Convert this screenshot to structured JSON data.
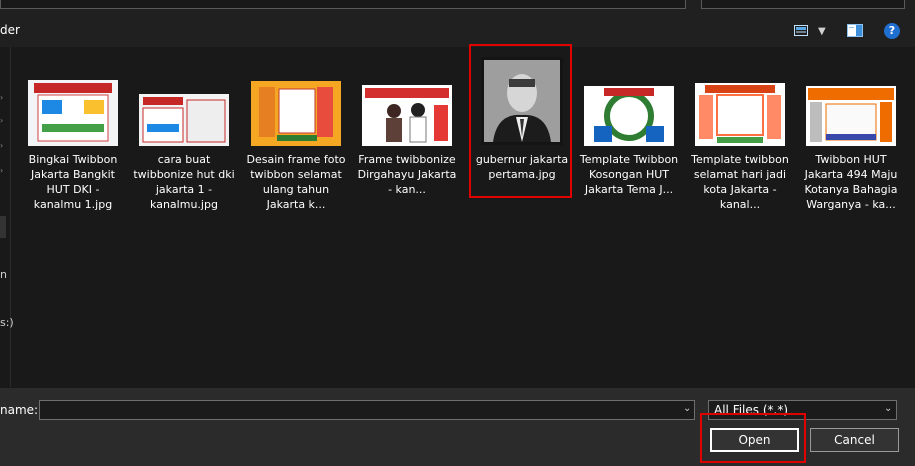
{
  "toolbar": {
    "new_folder_fragment": "der",
    "view_icon": "view-options-icon",
    "preview_icon": "preview-pane-icon",
    "help_glyph": "?"
  },
  "nav": {
    "frag_1": "n",
    "frag_2": "s:)"
  },
  "files": [
    {
      "name": "Bingkai Twibbon Jakarta Bangkit HUT DKI - kanalmu 1.jpg"
    },
    {
      "name": "cara buat twibbonize hut dki jakarta 1 - kanalmu.jpg"
    },
    {
      "name": "Desain frame foto twibbon selamat ulang tahun Jakarta k..."
    },
    {
      "name": "Frame twibbonize Dirgahayu Jakarta - kan..."
    },
    {
      "name": "gubernur jakarta pertama.jpg"
    },
    {
      "name": "Template Twibbon Kosongan HUT Jakarta  Tema J..."
    },
    {
      "name": "Template twibbon selamat hari jadi kota Jakarta - kanal..."
    },
    {
      "name": "Twibbon HUT Jakarta 494 Maju Kotanya Bahagia Warganya - ka..."
    }
  ],
  "bottom": {
    "file_name_label": "name:",
    "file_name_value": "",
    "filter_value": "All Files (*.*)",
    "open_label": "Open",
    "cancel_label": "Cancel"
  },
  "colors": {
    "background": "#191919",
    "bottom_bar": "#2b2b2b",
    "highlight": "#e00000",
    "help_blue": "#1f6fd0"
  }
}
